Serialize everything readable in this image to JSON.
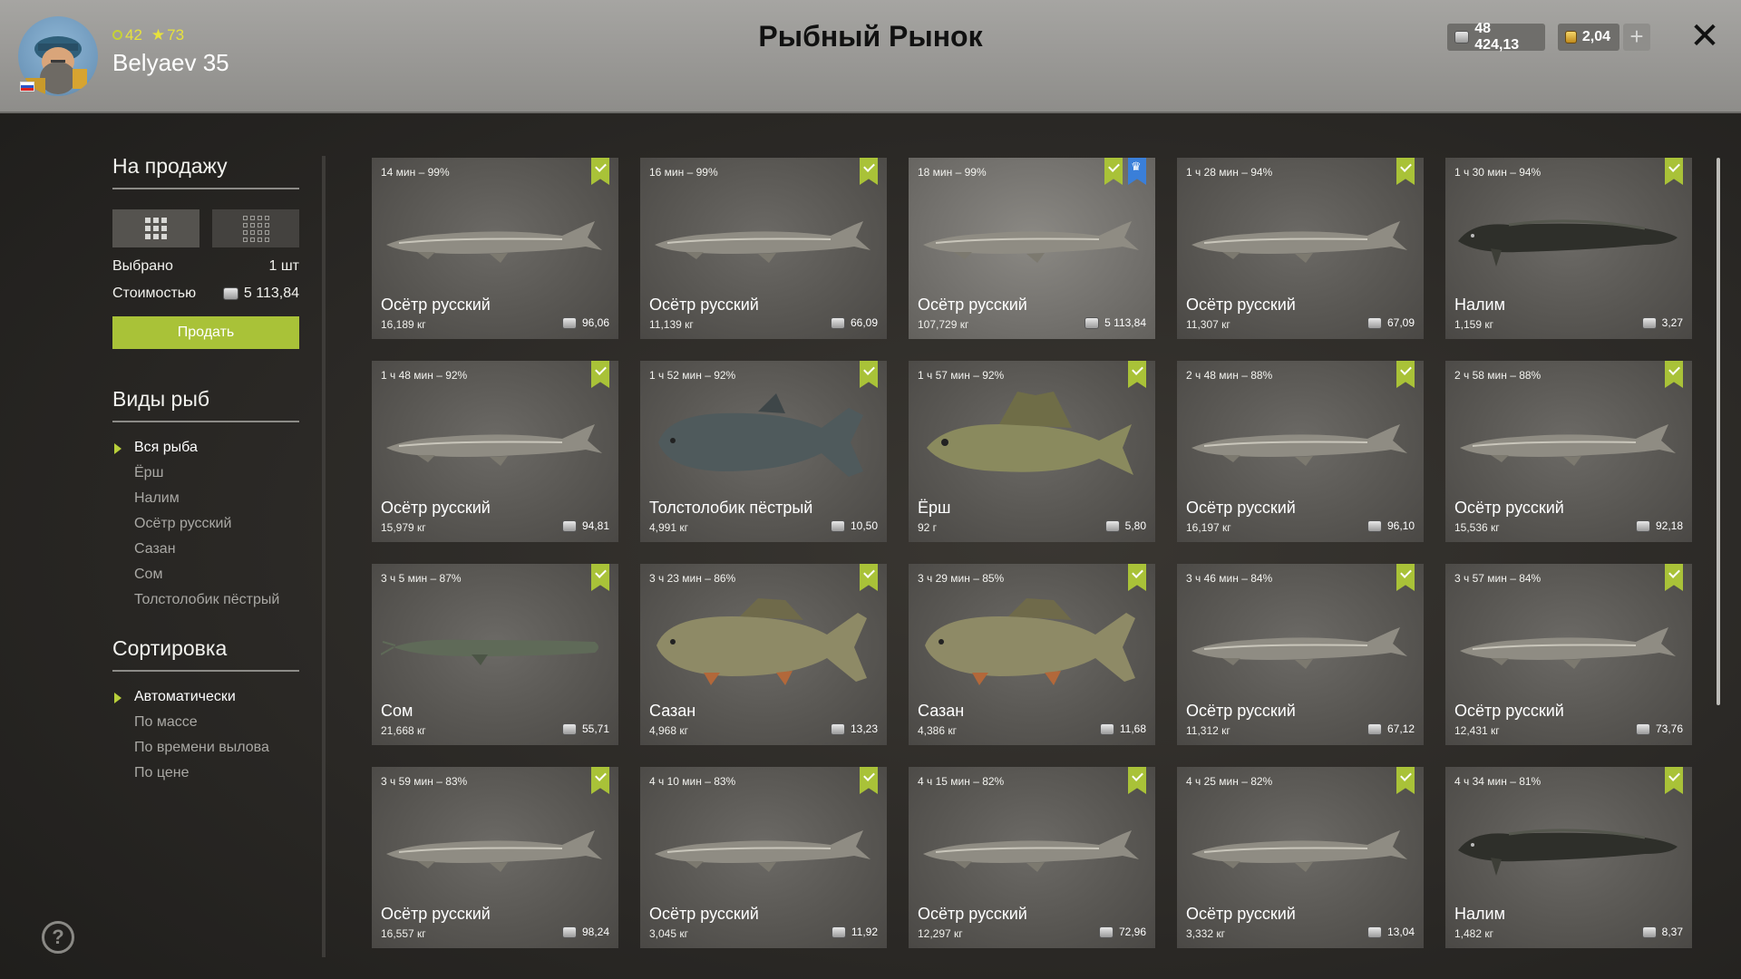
{
  "header": {
    "title": "Рыбный Рынок",
    "level": "42",
    "stars": "73",
    "username": "Belyaev 35",
    "silver": "48 424,13",
    "gold": "2,04",
    "add_label": "+",
    "close_label": "✕"
  },
  "sidebar": {
    "sale_title": "На продажу",
    "selected_label": "Выбрано",
    "selected_value": "1 шт",
    "cost_label": "Стоимостью",
    "cost_value": "5 113,84",
    "sell_button": "Продать",
    "species_title": "Виды рыб",
    "species": [
      "Вся рыба",
      "Ёрш",
      "Налим",
      "Осётр русский",
      "Сазан",
      "Сом",
      "Толстолобик пёстрый"
    ],
    "sort_title": "Сортировка",
    "sort_options": [
      "Автоматически",
      "По массе",
      "По времени вылова",
      "По цене"
    ],
    "help_label": "?"
  },
  "colors": {
    "accent": "#a9c238",
    "crown": "#3a7fd9"
  },
  "cards": [
    {
      "time": "14 мин – 99%",
      "name": "Осётр русский",
      "weight": "16,189 кг",
      "price": "96,06",
      "fish": "sturgeon"
    },
    {
      "time": "16 мин – 99%",
      "name": "Осётр русский",
      "weight": "11,139 кг",
      "price": "66,09",
      "fish": "sturgeon"
    },
    {
      "time": "18 мин – 99%",
      "name": "Осётр русский",
      "weight": "107,729 кг",
      "price": "5 113,84",
      "fish": "sturgeon",
      "selected": true,
      "crown": true
    },
    {
      "time": "1 ч 28 мин – 94%",
      "name": "Осётр русский",
      "weight": "11,307 кг",
      "price": "67,09",
      "fish": "sturgeon"
    },
    {
      "time": "1 ч 30 мин – 94%",
      "name": "Налим",
      "weight": "1,159 кг",
      "price": "3,27",
      "fish": "burbot"
    },
    {
      "time": "1 ч 48 мин – 92%",
      "name": "Осётр русский",
      "weight": "15,979 кг",
      "price": "94,81",
      "fish": "sturgeon"
    },
    {
      "time": "1 ч 52 мин – 92%",
      "name": "Толстолобик пёстрый",
      "weight": "4,991 кг",
      "price": "10,50",
      "fish": "carp-big"
    },
    {
      "time": "1 ч 57 мин – 92%",
      "name": "Ёрш",
      "weight": "92 г",
      "price": "5,80",
      "fish": "ruffe"
    },
    {
      "time": "2 ч 48 мин – 88%",
      "name": "Осётр русский",
      "weight": "16,197 кг",
      "price": "96,10",
      "fish": "sturgeon"
    },
    {
      "time": "2 ч 58 мин – 88%",
      "name": "Осётр русский",
      "weight": "15,536 кг",
      "price": "92,18",
      "fish": "sturgeon"
    },
    {
      "time": "3 ч 5 мин – 87%",
      "name": "Сом",
      "weight": "21,668 кг",
      "price": "55,71",
      "fish": "catfish"
    },
    {
      "time": "3 ч 23 мин – 86%",
      "name": "Сазан",
      "weight": "4,968 кг",
      "price": "13,23",
      "fish": "carp"
    },
    {
      "time": "3 ч 29 мин – 85%",
      "name": "Сазан",
      "weight": "4,386 кг",
      "price": "11,68",
      "fish": "carp"
    },
    {
      "time": "3 ч 46 мин – 84%",
      "name": "Осётр русский",
      "weight": "11,312 кг",
      "price": "67,12",
      "fish": "sturgeon"
    },
    {
      "time": "3 ч 57 мин – 84%",
      "name": "Осётр русский",
      "weight": "12,431 кг",
      "price": "73,76",
      "fish": "sturgeon"
    },
    {
      "time": "3 ч 59 мин – 83%",
      "name": "Осётр русский",
      "weight": "16,557 кг",
      "price": "98,24",
      "fish": "sturgeon"
    },
    {
      "time": "4 ч 10 мин – 83%",
      "name": "Осётр русский",
      "weight": "3,045 кг",
      "price": "11,92",
      "fish": "sturgeon"
    },
    {
      "time": "4 ч 15 мин – 82%",
      "name": "Осётр русский",
      "weight": "12,297 кг",
      "price": "72,96",
      "fish": "sturgeon"
    },
    {
      "time": "4 ч 25 мин – 82%",
      "name": "Осётр русский",
      "weight": "3,332 кг",
      "price": "13,04",
      "fish": "sturgeon"
    },
    {
      "time": "4 ч 34 мин – 81%",
      "name": "Налим",
      "weight": "1,482 кг",
      "price": "8,37",
      "fish": "burbot"
    }
  ]
}
